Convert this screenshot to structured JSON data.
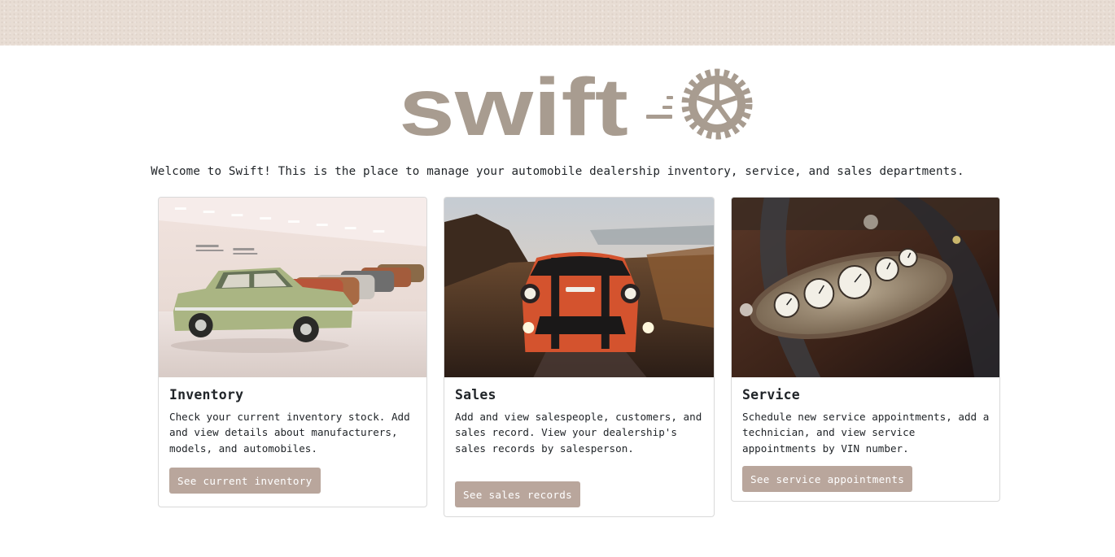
{
  "header": {
    "logo_text": "swift"
  },
  "welcome_text": "Welcome to Swift! This is the place to manage your automobile dealership inventory, service, and sales departments.",
  "colors": {
    "topbar": "#e8ddd4",
    "logo": "#a89c90",
    "button": "#b9a69c"
  },
  "cards": [
    {
      "title": "Inventory",
      "text": "Check your current inventory stock. Add and view details about manufacturers, models, and automobiles.",
      "button_label": "See current inventory",
      "image": "vintage-cars-showroom"
    },
    {
      "title": "Sales",
      "text": "Add and view salespeople, customers, and sales record. View your dealership's sales records by salesperson.",
      "button_label": "See sales records",
      "image": "orange-mini-cooper"
    },
    {
      "title": "Service",
      "text": "Schedule new service appointments, add a technician, and view service appointments by VIN number.",
      "button_label": "See service appointments",
      "image": "vintage-dashboard-gauges"
    }
  ]
}
